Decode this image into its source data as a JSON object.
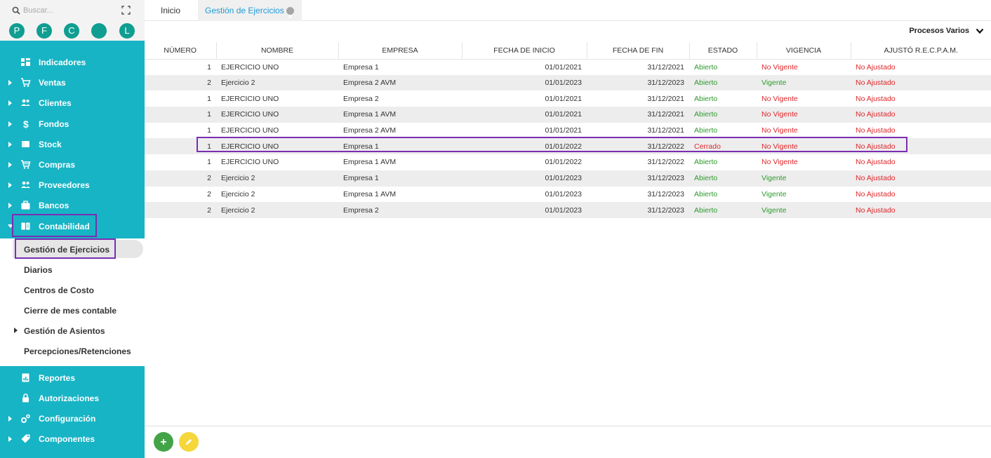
{
  "sidebar": {
    "search_placeholder": "Buscar...",
    "avatars": [
      "P",
      "F",
      "C",
      "",
      "L"
    ],
    "menu": [
      {
        "label": "Indicadores",
        "icon": "dashboard-icon",
        "caret": false
      },
      {
        "label": "Ventas",
        "icon": "cart-icon",
        "caret": true
      },
      {
        "label": "Clientes",
        "icon": "people-icon",
        "caret": true
      },
      {
        "label": "Fondos",
        "icon": "dollar-icon",
        "caret": true
      },
      {
        "label": "Stock",
        "icon": "box-icon",
        "caret": true
      },
      {
        "label": "Compras",
        "icon": "basket-icon",
        "caret": true
      },
      {
        "label": "Proveedores",
        "icon": "people-icon",
        "caret": true
      },
      {
        "label": "Bancos",
        "icon": "briefcase-icon",
        "caret": true
      },
      {
        "label": "Contabilidad",
        "icon": "ledger-icon",
        "caret": true,
        "expanded": true
      }
    ],
    "submenu": [
      {
        "label": "Gestión de Ejercicios",
        "active": true
      },
      {
        "label": "Diarios"
      },
      {
        "label": "Centros de Costo"
      },
      {
        "label": "Cierre de mes contable"
      },
      {
        "label": "Gestión de Asientos",
        "caret": true
      },
      {
        "label": "Percepciones/Retenciones"
      }
    ],
    "menu_bottom": [
      {
        "label": "Reportes",
        "icon": "report-icon",
        "caret": false
      },
      {
        "label": "Autorizaciones",
        "icon": "lock-icon",
        "caret": false
      },
      {
        "label": "Configuración",
        "icon": "gears-icon",
        "caret": true
      },
      {
        "label": "Componentes",
        "icon": "tag-icon",
        "caret": true
      }
    ]
  },
  "tabs": {
    "inicio": "Inicio",
    "gestion": "Gestión de Ejercicios"
  },
  "toolbar": {
    "procesos": "Procesos Varios"
  },
  "table": {
    "headers": [
      "Número",
      "Nombre",
      "Empresa",
      "Fecha de inicio",
      "Fecha de fin",
      "Estado",
      "Vigencia",
      "Ajustó R.E.C.P.A.M."
    ],
    "rows": [
      [
        "1",
        "EJERCICIO UNO",
        "Empresa 1",
        "01/01/2021",
        "31/12/2021",
        "Abierto",
        "No Vigente",
        "No Ajustado"
      ],
      [
        "2",
        "Ejercicio 2",
        "Empresa 2 AVM",
        "01/01/2023",
        "31/12/2023",
        "Abierto",
        "Vigente",
        "No Ajustado"
      ],
      [
        "1",
        "EJERCICIO UNO",
        "Empresa 2",
        "01/01/2021",
        "31/12/2021",
        "Abierto",
        "No Vigente",
        "No Ajustado"
      ],
      [
        "1",
        "EJERCICIO UNO",
        "Empresa 1 AVM",
        "01/01/2021",
        "31/12/2021",
        "Abierto",
        "No Vigente",
        "No Ajustado"
      ],
      [
        "1",
        "EJERCICIO UNO",
        "Empresa 2 AVM",
        "01/01/2021",
        "31/12/2021",
        "Abierto",
        "No Vigente",
        "No Ajustado"
      ],
      [
        "1",
        "EJERCICIO UNO",
        "Empresa 1",
        "01/01/2022",
        "31/12/2022",
        "Cerrado",
        "No Vigente",
        "No Ajustado"
      ],
      [
        "1",
        "EJERCICIO UNO",
        "Empresa 1 AVM",
        "01/01/2022",
        "31/12/2022",
        "Abierto",
        "No Vigente",
        "No Ajustado"
      ],
      [
        "2",
        "Ejercicio 2",
        "Empresa 1",
        "01/01/2023",
        "31/12/2023",
        "Abierto",
        "Vigente",
        "No Ajustado"
      ],
      [
        "2",
        "Ejercicio 2",
        "Empresa 1 AVM",
        "01/01/2023",
        "31/12/2023",
        "Abierto",
        "Vigente",
        "No Ajustado"
      ],
      [
        "2",
        "Ejercicio 2",
        "Empresa 2",
        "01/01/2023",
        "31/12/2023",
        "Abierto",
        "Vigente",
        "No Ajustado"
      ]
    ],
    "highlighted_row": 5
  },
  "colors": {
    "sidebar": "#17b4c5",
    "avatar": "#0f9e91",
    "highlight": "#7b2db3",
    "green": "#2e9a2e",
    "red": "#e0262a",
    "tab_active": "#1d9bd8",
    "add_button": "#43a447",
    "edit_button": "#f5d73c"
  }
}
